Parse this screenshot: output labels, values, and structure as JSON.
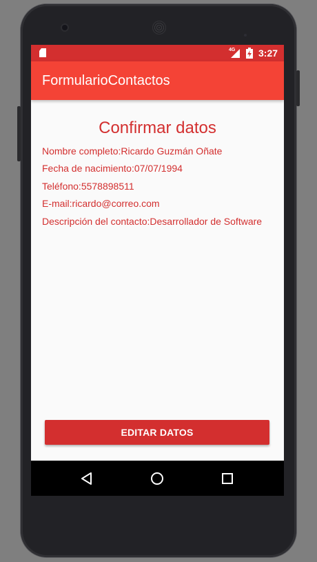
{
  "status_bar": {
    "sd_icon": "sd-card-icon",
    "network_type": "4G",
    "signal_icon": "signal-icon",
    "battery_icon": "battery-charging-icon",
    "time": "3:27"
  },
  "app_bar": {
    "title": "FormularioContactos"
  },
  "content": {
    "heading": "Confirmar datos",
    "fields": [
      "Nombre completo:Ricardo Guzmán Oñate",
      "Fecha de nacimiento:07/07/1994",
      "Teléfono:5578898511",
      "E-mail:ricardo@correo.com",
      "Descripción del contacto:Desarrollador de Software"
    ]
  },
  "actions": {
    "edit_label": "EDITAR DATOS"
  },
  "nav_bar": {
    "back_icon": "back-icon",
    "home_icon": "home-icon",
    "recents_icon": "recents-icon"
  },
  "colors": {
    "status_bar": "#d32f2f",
    "app_bar": "#f44336",
    "accent_text": "#d32f2f",
    "button": "#d32f2f",
    "background": "#fafafa"
  }
}
